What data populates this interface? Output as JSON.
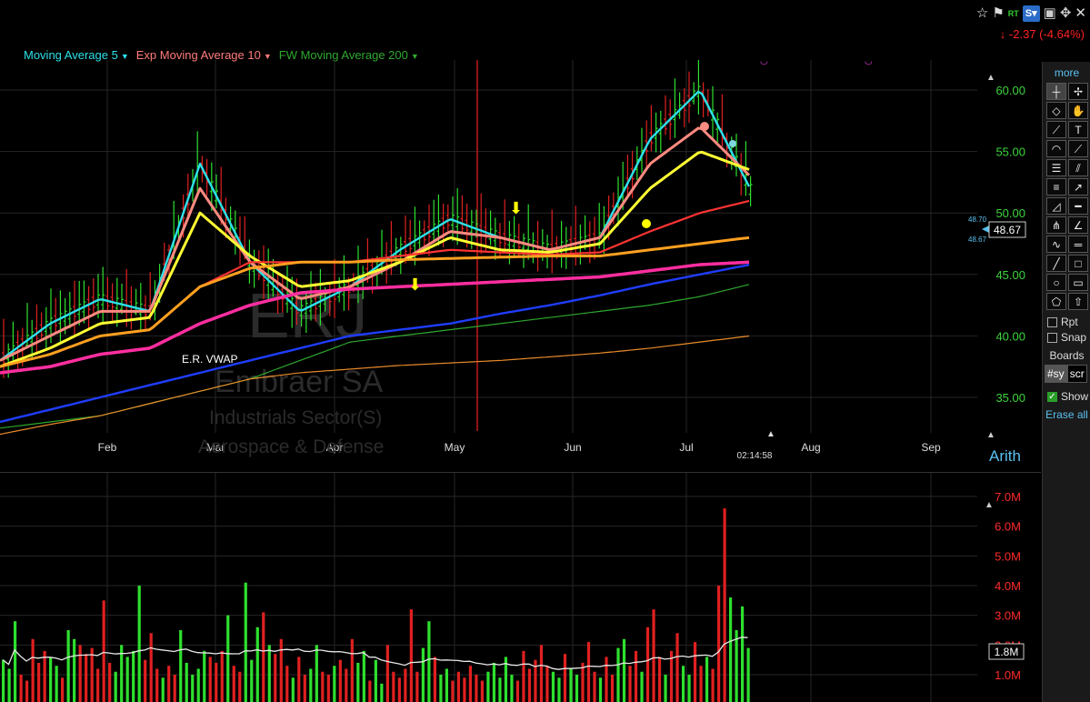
{
  "toolbar": {
    "icons": [
      "star-icon",
      "flag-icon",
      "realtime-icon",
      "s-icon",
      "save-icon",
      "move-icon",
      "close-icon"
    ],
    "rt_label": "RT",
    "s_label": "S▾"
  },
  "price_change": "↓ -2.37 (-4.64%)",
  "legend": [
    {
      "label": "Moving Average 5",
      "color": "#2de0e8"
    },
    {
      "label": "Exp Moving Average 10",
      "color": "#ff7b7b"
    },
    {
      "label": "FW Moving Average 200",
      "color": "#2ea82e"
    }
  ],
  "watermark": {
    "symbol": "ERJ",
    "name": "Embraer SA",
    "sector": "Industrials Sector(S)",
    "industry": "Aerospace & Defense"
  },
  "annotation_vwap": "E.R. VWAP",
  "clock": "02:14:58",
  "scale_mode": "Arith",
  "price_labels": {
    "left_upper": "48.70",
    "left_lower": "48.67",
    "current": "48.67"
  },
  "volume_current": "1.8M",
  "sidebar": {
    "more": "more",
    "tools": [
      "crosshair",
      "cursor",
      "eraser",
      "hand",
      "line",
      "text",
      "arc",
      "fan",
      "hgrid",
      "channel",
      "fib",
      "ray",
      "triangle",
      "dash",
      "pitchfork",
      "angle",
      "sine",
      "hline",
      "slope",
      "square",
      "circle",
      "rect",
      "pentagon",
      "arrow"
    ],
    "rpt": "Rpt",
    "snap": "Snap",
    "boards": "Boards",
    "tabs": [
      "#sy",
      "scr"
    ],
    "show": "Show",
    "erase_all": "Erase all"
  },
  "chart_data": [
    {
      "type": "line",
      "title": "",
      "x": [
        "Feb",
        "Mar",
        "Apr",
        "May",
        "Jun",
        "Jul",
        "Aug",
        "Sep"
      ],
      "y_ticks": [
        35.0,
        40.0,
        45.0,
        50.0,
        55.0,
        60.0
      ],
      "ylim": [
        32.5,
        62.5
      ],
      "series": [
        {
          "name": "Moving Average 5",
          "color": "#2de0e8",
          "values": [
            38,
            41,
            43,
            42,
            54,
            46,
            42,
            44,
            47,
            49.5,
            48,
            47,
            48,
            56,
            60,
            52
          ]
        },
        {
          "name": "Exp Moving Average 10",
          "color": "#ff8a80",
          "values": [
            38,
            40,
            42,
            42,
            52,
            46,
            43,
            44,
            46,
            48.5,
            48,
            47,
            48,
            54,
            57,
            53
          ]
        },
        {
          "name": "",
          "color": "#ffff33",
          "values": [
            37.5,
            39,
            41,
            41.5,
            50,
            46.5,
            44,
            44.5,
            46,
            48,
            47,
            46.8,
            47.5,
            52,
            55,
            53.5
          ]
        },
        {
          "name": "",
          "color": "#ff3333",
          "values": [
            37.5,
            38.5,
            40,
            40.5,
            44,
            46,
            46,
            46,
            46.5,
            47,
            46.8,
            46.6,
            46.8,
            48.5,
            50,
            51
          ]
        },
        {
          "name": "",
          "color": "#ffa020",
          "values": [
            37.5,
            38.5,
            40,
            40.5,
            44,
            45.5,
            46,
            46,
            46.2,
            46.3,
            46.4,
            46.5,
            46.5,
            47,
            47.5,
            48
          ]
        },
        {
          "name": "",
          "color": "#ff2ea0",
          "values": [
            37,
            37.5,
            38.5,
            39,
            41,
            42.5,
            43.5,
            43.8,
            44,
            44.2,
            44.4,
            44.6,
            44.8,
            45.3,
            45.8,
            46
          ]
        },
        {
          "name": "",
          "color": "#1f3dff",
          "values": [
            33,
            34,
            35,
            36,
            37,
            38,
            39,
            40,
            40.5,
            41,
            41.8,
            42.5,
            43.3,
            44.2,
            45,
            45.8
          ]
        },
        {
          "name": "FW Moving Average 200",
          "color": "#2ea82e",
          "values": [
            32.5,
            33,
            33.5,
            34.5,
            35.5,
            36.5,
            38,
            39.5,
            40,
            40.5,
            41,
            41.5,
            42,
            42.5,
            43.2,
            44.2
          ]
        },
        {
          "name": "",
          "color": "#e88a2a",
          "values": [
            32,
            32.8,
            33.5,
            34.5,
            35.5,
            36.5,
            37,
            37.3,
            37.6,
            37.8,
            38,
            38.3,
            38.6,
            39,
            39.5,
            40
          ]
        }
      ]
    },
    {
      "type": "bar",
      "title": "",
      "y_ticks": [
        "1.0M",
        "2.0M",
        "3.0M",
        "4.0M",
        "5.0M",
        "6.0M",
        "7.0M"
      ],
      "ylim": [
        0,
        7.5
      ],
      "values": [
        1.5,
        1.2,
        2.8,
        1.0,
        0.8,
        2.2,
        1.4,
        1.8,
        1.6,
        1.3,
        0.9,
        2.5,
        2.2,
        2.0,
        1.7,
        1.9,
        1.2,
        3.5,
        1.4,
        1.1,
        2.0,
        1.6,
        1.8,
        4.0,
        1.5,
        2.4,
        1.2,
        0.9,
        1.3,
        1.0,
        2.5,
        1.4,
        1.0,
        1.2,
        1.8,
        1.6,
        1.4,
        1.8,
        3.0,
        1.3,
        1.1,
        4.1,
        1.5,
        2.6,
        3.1,
        2.0,
        1.7,
        2.2,
        1.3,
        0.9,
        1.6,
        1.0,
        1.2,
        2.0,
        1.1,
        1.0,
        1.3,
        1.5,
        1.2,
        2.2,
        1.4,
        1.8,
        0.8,
        1.5,
        0.7,
        2.0,
        1.1,
        0.9,
        1.2,
        3.2,
        1.1,
        1.9,
        2.8,
        1.6,
        1.0,
        1.2,
        0.8,
        1.1,
        0.9,
        1.3,
        1.0,
        0.8,
        1.1,
        1.4,
        0.9,
        1.6,
        1.0,
        0.8,
        1.8,
        1.2,
        1.5,
        2.0,
        1.3,
        1.1,
        0.9,
        1.7,
        1.2,
        1.0,
        1.4,
        2.1,
        1.1,
        0.9,
        1.6,
        1.0,
        1.9,
        2.2,
        1.3,
        1.8,
        1.1,
        2.6,
        3.2,
        1.6,
        1.0,
        1.8,
        2.4,
        1.3,
        1.0,
        2.1,
        1.3,
        1.6,
        1.2,
        4.0,
        6.6,
        3.6,
        2.5,
        3.3,
        1.9
      ]
    }
  ]
}
